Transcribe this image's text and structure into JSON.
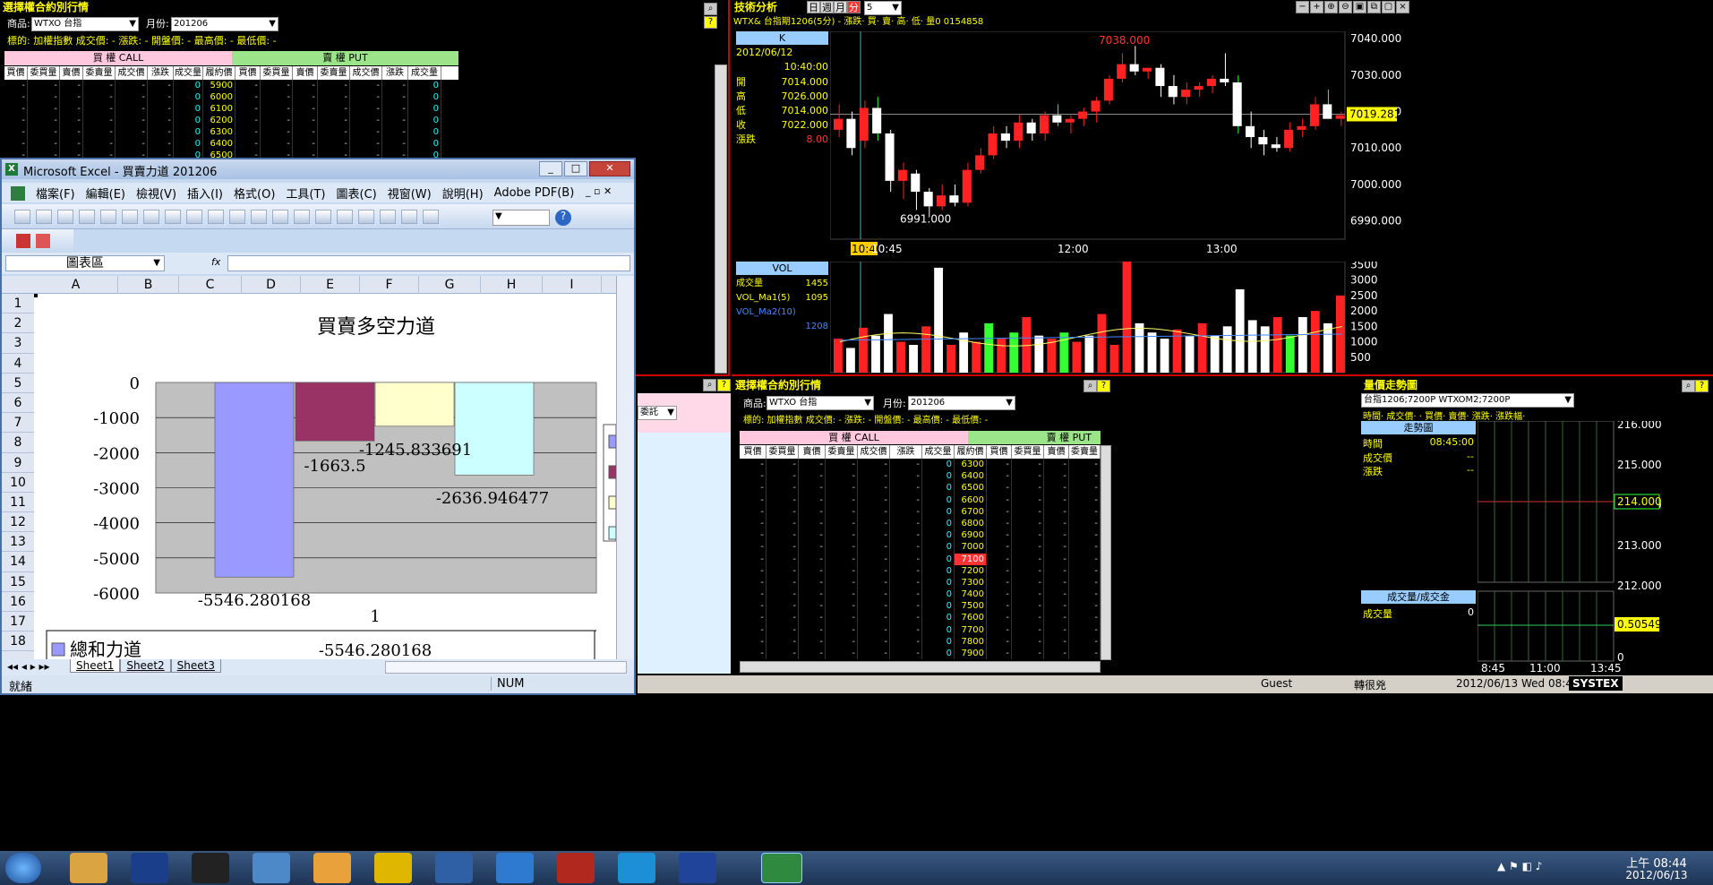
{
  "left_top_panel": {
    "title": "選擇權合約別行情",
    "product_label": "商品:",
    "product_value": "WTXO 台指",
    "month_label": "月份:",
    "month_value": "201206",
    "underlying": "標的: 加權指數   成交價:   -   漲跌: -   開盤價: -   最高價: -   最低價: -",
    "call_header": "買 權 CALL",
    "put_header": "賣 權 PUT",
    "columns": [
      "買價",
      "委買量",
      "賣價",
      "委賣量",
      "成交價",
      "漲跌",
      "成交量",
      "履約價",
      "買價",
      "委買量",
      "賣價",
      "委賣量",
      "成交價",
      "漲跌",
      "成交量"
    ],
    "strikes": [
      "5900",
      "6000",
      "6100",
      "6200",
      "6300",
      "6400",
      "6500"
    ]
  },
  "tech": {
    "title": "技術分析",
    "periods": [
      "日",
      "週",
      "月",
      "分"
    ],
    "interval": "5",
    "symbol_line": "WTX& 台指期1206(5分)   -   漲跌·   買·   賣·   高·   低·   量0   0154858",
    "k_label": "K",
    "date": "2012/06/12",
    "time": "10:40:00",
    "ohlc": [
      {
        "k": "開",
        "v": "7014.000"
      },
      {
        "k": "高",
        "v": "7026.000"
      },
      {
        "k": "低",
        "v": "7014.000"
      },
      {
        "k": "收",
        "v": "7022.000"
      },
      {
        "k": "漲跌",
        "v": "8.00"
      }
    ],
    "price_ticks": [
      "7040.000",
      "7030.000",
      "7020.000",
      "7010.000",
      "7000.000",
      "6990.000"
    ],
    "current_price": "7019.281",
    "high_label": "7038.000",
    "low_label": "6991.000",
    "time_ticks": [
      "10:40",
      "10:45",
      "12:00",
      "13:00"
    ],
    "vol_label": "VOL",
    "vol_rows": [
      {
        "k": "成交量",
        "v": "1455"
      },
      {
        "k": "VOL_Ma1(5)",
        "v": "1095"
      },
      {
        "k": "VOL_Ma2(10)",
        "v": ""
      },
      {
        "k": "",
        "v": "1208"
      }
    ],
    "vol_ticks": [
      "3500",
      "3000",
      "2500",
      "2000",
      "1500",
      "1000",
      "500"
    ]
  },
  "chart_data": [
    {
      "type": "candlestick",
      "title": "WTX& 台指期1206(5分)",
      "ylim": [
        6985,
        7042
      ],
      "candles": [
        [
          7015,
          7022,
          7013,
          7018
        ],
        [
          7018,
          7020,
          7008,
          7010
        ],
        [
          7012,
          7023,
          7010,
          7021
        ],
        [
          7021,
          7024,
          7012,
          7014
        ],
        [
          7014,
          7015,
          6998,
          7001
        ],
        [
          7001,
          7006,
          6996,
          7004
        ],
        [
          7003,
          7004,
          6993,
          6998
        ],
        [
          6998,
          6999,
          6991,
          6994
        ],
        [
          6994,
          7000,
          6993,
          6997
        ],
        [
          6997,
          7000,
          6994,
          6995
        ],
        [
          6995,
          7006,
          6994,
          7004
        ],
        [
          7004,
          7010,
          7003,
          7008
        ],
        [
          7008,
          7016,
          7007,
          7014
        ],
        [
          7014,
          7016,
          7010,
          7012
        ],
        [
          7012,
          7019,
          7010,
          7017
        ],
        [
          7017,
          7018,
          7012,
          7014
        ],
        [
          7014,
          7020,
          7012,
          7019
        ],
        [
          7019,
          7022,
          7016,
          7017
        ],
        [
          7017,
          7019,
          7014,
          7018
        ],
        [
          7018,
          7021,
          7016,
          7020
        ],
        [
          7020,
          7024,
          7017,
          7023
        ],
        [
          7023,
          7030,
          7022,
          7029
        ],
        [
          7029,
          7036,
          7028,
          7033
        ],
        [
          7033,
          7038,
          7030,
          7031
        ],
        [
          7031,
          7032,
          7029,
          7032
        ],
        [
          7032,
          7033,
          7024,
          7027
        ],
        [
          7027,
          7030,
          7022,
          7024
        ],
        [
          7024,
          7028,
          7022,
          7026
        ],
        [
          7026,
          7028,
          7024,
          7027
        ],
        [
          7027,
          7030,
          7025,
          7029
        ],
        [
          7029,
          7036,
          7027,
          7028
        ],
        [
          7028,
          7030,
          7014,
          7016
        ],
        [
          7016,
          7020,
          7010,
          7013
        ],
        [
          7013,
          7015,
          7008,
          7011
        ],
        [
          7011,
          7013,
          7009,
          7010
        ],
        [
          7010,
          7017,
          7009,
          7015
        ],
        [
          7015,
          7018,
          7013,
          7016
        ],
        [
          7016,
          7024,
          7015,
          7022
        ],
        [
          7022,
          7026,
          7018,
          7018
        ],
        [
          7018,
          7020,
          7016,
          7019
        ]
      ]
    },
    {
      "type": "bar",
      "title": "VOL",
      "ylim": [
        0,
        3600
      ],
      "values": [
        1100,
        800,
        1455,
        1200,
        1900,
        1000,
        900,
        1500,
        3400,
        900,
        1300,
        1000,
        1600,
        1100,
        1300,
        1800,
        1200,
        1100,
        1300,
        1000,
        1200,
        1900,
        900,
        3700,
        1600,
        1300,
        1100,
        1400,
        1200,
        1600,
        1200,
        1500,
        2700,
        1700,
        1500,
        1800,
        1200,
        1800,
        2000,
        1600,
        2500
      ]
    },
    {
      "type": "bar",
      "title": "買賣多空力道",
      "categories": [
        "1"
      ],
      "series": [
        {
          "name": "總和力道",
          "values": [
            -5546.280168
          ]
        },
        {
          "name": "",
          "values": [
            -1663.5
          ]
        },
        {
          "name": "",
          "values": [
            -1245.833691
          ]
        },
        {
          "name": "",
          "values": [
            -2636.946477
          ]
        }
      ],
      "ylim": [
        -6000,
        0
      ],
      "yticks": [
        "0",
        "-1000",
        "-2000",
        "-3000",
        "-4000",
        "-5000",
        "-6000"
      ]
    }
  ],
  "excel": {
    "title": "Microsoft Excel - 買賣力道 201206",
    "menus": [
      "檔案(F)",
      "編輯(E)",
      "檢視(V)",
      "插入(I)",
      "格式(O)",
      "工具(T)",
      "圖表(C)",
      "視窗(W)",
      "說明(H)",
      "Adobe PDF(B)"
    ],
    "name_box": "圖表區",
    "fx": "fx",
    "columns": [
      "A",
      "B",
      "C",
      "D",
      "E",
      "F",
      "G",
      "H",
      "I"
    ],
    "rows": [
      "1",
      "2",
      "3",
      "4",
      "5",
      "6",
      "7",
      "8",
      "9",
      "10",
      "11",
      "12",
      "13",
      "14",
      "15",
      "16",
      "17",
      "18"
    ],
    "chart_title": "買賣多空力道",
    "bar_labels": [
      "-5546.280168",
      "-1663.5",
      "-1245.833691",
      "-2636.946477"
    ],
    "table_category": "1",
    "legend_name": "總和力道",
    "table_value": "-5546.280168",
    "sheets": [
      "Sheet1",
      "Sheet2",
      "Sheet3"
    ],
    "status": "就緒",
    "num": "NUM",
    "colors": [
      "#9999ff",
      "#993366",
      "#ffffcc",
      "#ccffff"
    ]
  },
  "mid_panel": {
    "label": "委託"
  },
  "bottom_center": {
    "title": "選擇權合約別行情",
    "product_label": "商品:",
    "product_value": "WTXO 台指",
    "month_label": "月份:",
    "month_value": "201206",
    "underlying": "標的: 加權指數   成交價:   -   漲跌: -   開盤價: -   最高價: -   最低價: -",
    "call_header": "買 權 CALL",
    "put_header": "賣 權 PUT",
    "columns": [
      "買價",
      "委買量",
      "賣價",
      "委賣量",
      "成交價",
      "漲跌",
      "成交量",
      "履約價",
      "買價",
      "委買量",
      "賣價",
      "委賣量"
    ],
    "strikes": [
      "6300",
      "6400",
      "6500",
      "6600",
      "6700",
      "6800",
      "6900",
      "7000",
      "7100",
      "7200",
      "7300",
      "7400",
      "7500",
      "7600",
      "7700",
      "7800",
      "7900"
    ],
    "highlight": "7100"
  },
  "right_bottom": {
    "title": "量價走勢圖",
    "selector": "台指1206;7200P   WTXOM2;7200P",
    "header": "時間·   成交價·   ·   買價·   賣價·   漲跌·   漲跌幅·",
    "trend_label": "走勢圖",
    "time_label": "時間",
    "time_value": "08:45:00",
    "price_label": "成交價",
    "price_value": "--",
    "chg_label": "漲跌",
    "chg_value": "--",
    "ticks": [
      "216.000",
      "215.000",
      "214.000",
      "213.000",
      "212.000"
    ],
    "cur": "214.000",
    "vol_btn": "成交量/成交金",
    "vol_label": "成交量",
    "vol_value": "0",
    "vol_ticks": [
      "0.50549",
      "0"
    ],
    "times": [
      "8:45",
      "11:00",
      "13:45"
    ]
  },
  "status_bar": {
    "user": "Guest",
    "msg": "轉很兇",
    "datetime": "2012/06/13 Wed 08:4",
    "brand": "SYSTEX"
  },
  "taskbar": {
    "time": "上午 08:44",
    "date": "2012/06/13"
  }
}
